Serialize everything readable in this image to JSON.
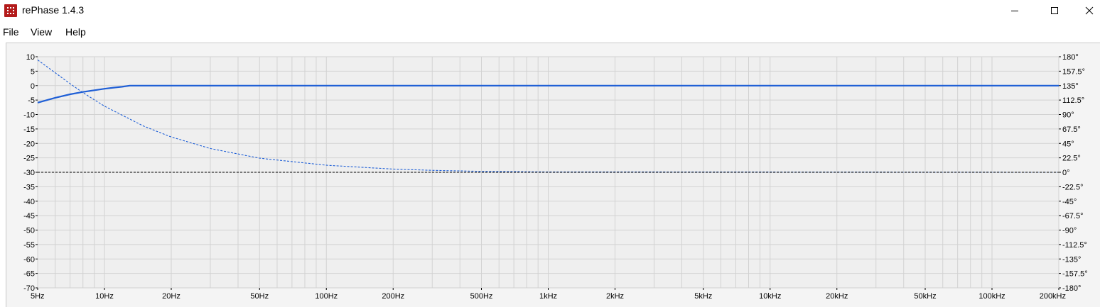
{
  "window": {
    "title": "rePhase 1.4.3",
    "app_icon": "rephase-app-icon",
    "controls": [
      "minimize-icon",
      "maximize-icon",
      "close-icon"
    ]
  },
  "menu": {
    "items": [
      "File",
      "View",
      "Help"
    ]
  },
  "chart_data": {
    "type": "line",
    "x_scale": "log",
    "xlim": [
      5,
      200000
    ],
    "x_ticks": [
      {
        "value": 5,
        "label": "5Hz"
      },
      {
        "value": 10,
        "label": "10Hz"
      },
      {
        "value": 20,
        "label": "20Hz"
      },
      {
        "value": 50,
        "label": "50Hz"
      },
      {
        "value": 100,
        "label": "100Hz"
      },
      {
        "value": 200,
        "label": "200Hz"
      },
      {
        "value": 500,
        "label": "500Hz"
      },
      {
        "value": 1000,
        "label": "1kHz"
      },
      {
        "value": 2000,
        "label": "2kHz"
      },
      {
        "value": 5000,
        "label": "5kHz"
      },
      {
        "value": 10000,
        "label": "10kHz"
      },
      {
        "value": 20000,
        "label": "20kHz"
      },
      {
        "value": 50000,
        "label": "50kHz"
      },
      {
        "value": 100000,
        "label": "100kHz"
      },
      {
        "value": 200000,
        "label": "200kHz"
      }
    ],
    "ylim_left": [
      -70,
      10
    ],
    "y_ticks_left": [
      "10",
      "5",
      "0",
      "-5",
      "-10",
      "-15",
      "-20",
      "-25",
      "-30",
      "-35",
      "-40",
      "-45",
      "-50",
      "-55",
      "-60",
      "-65",
      "-70"
    ],
    "ylim_right": [
      -180,
      180
    ],
    "y_ticks_right": [
      "180°",
      "157.5°",
      "135°",
      "112.5°",
      "90°",
      "67.5°",
      "45°",
      "22.5°",
      "0°",
      "-22.5°",
      "-45°",
      "-67.5°",
      "-90°",
      "-112.5°",
      "-135°",
      "-157.5°",
      "-180°"
    ],
    "grid": true,
    "series": [
      {
        "style": "solid",
        "color": "#1f5fd6",
        "axis": "left",
        "x": [
          5,
          6,
          7,
          8,
          9,
          10,
          11,
          12,
          13,
          20,
          50,
          100,
          1000,
          10000,
          200000
        ],
        "y": [
          -5.9,
          -4.2,
          -3.0,
          -2.2,
          -1.6,
          -1.1,
          -0.7,
          -0.4,
          0,
          0,
          0,
          0,
          0,
          0,
          0
        ]
      },
      {
        "style": "dashed",
        "color": "#1f5fd6",
        "axis": "right",
        "x": [
          5,
          6,
          7,
          8,
          10,
          15,
          20,
          30,
          50,
          100,
          200,
          300,
          500,
          1000,
          200000
        ],
        "y": [
          175,
          155,
          138,
          124,
          103,
          72,
          55,
          37,
          22,
          11,
          5,
          3,
          1.5,
          0.5,
          0
        ]
      },
      {
        "style": "dashed",
        "color": "#000000",
        "axis": "right",
        "x": [
          5,
          200000
        ],
        "y": [
          0,
          0
        ]
      }
    ]
  }
}
